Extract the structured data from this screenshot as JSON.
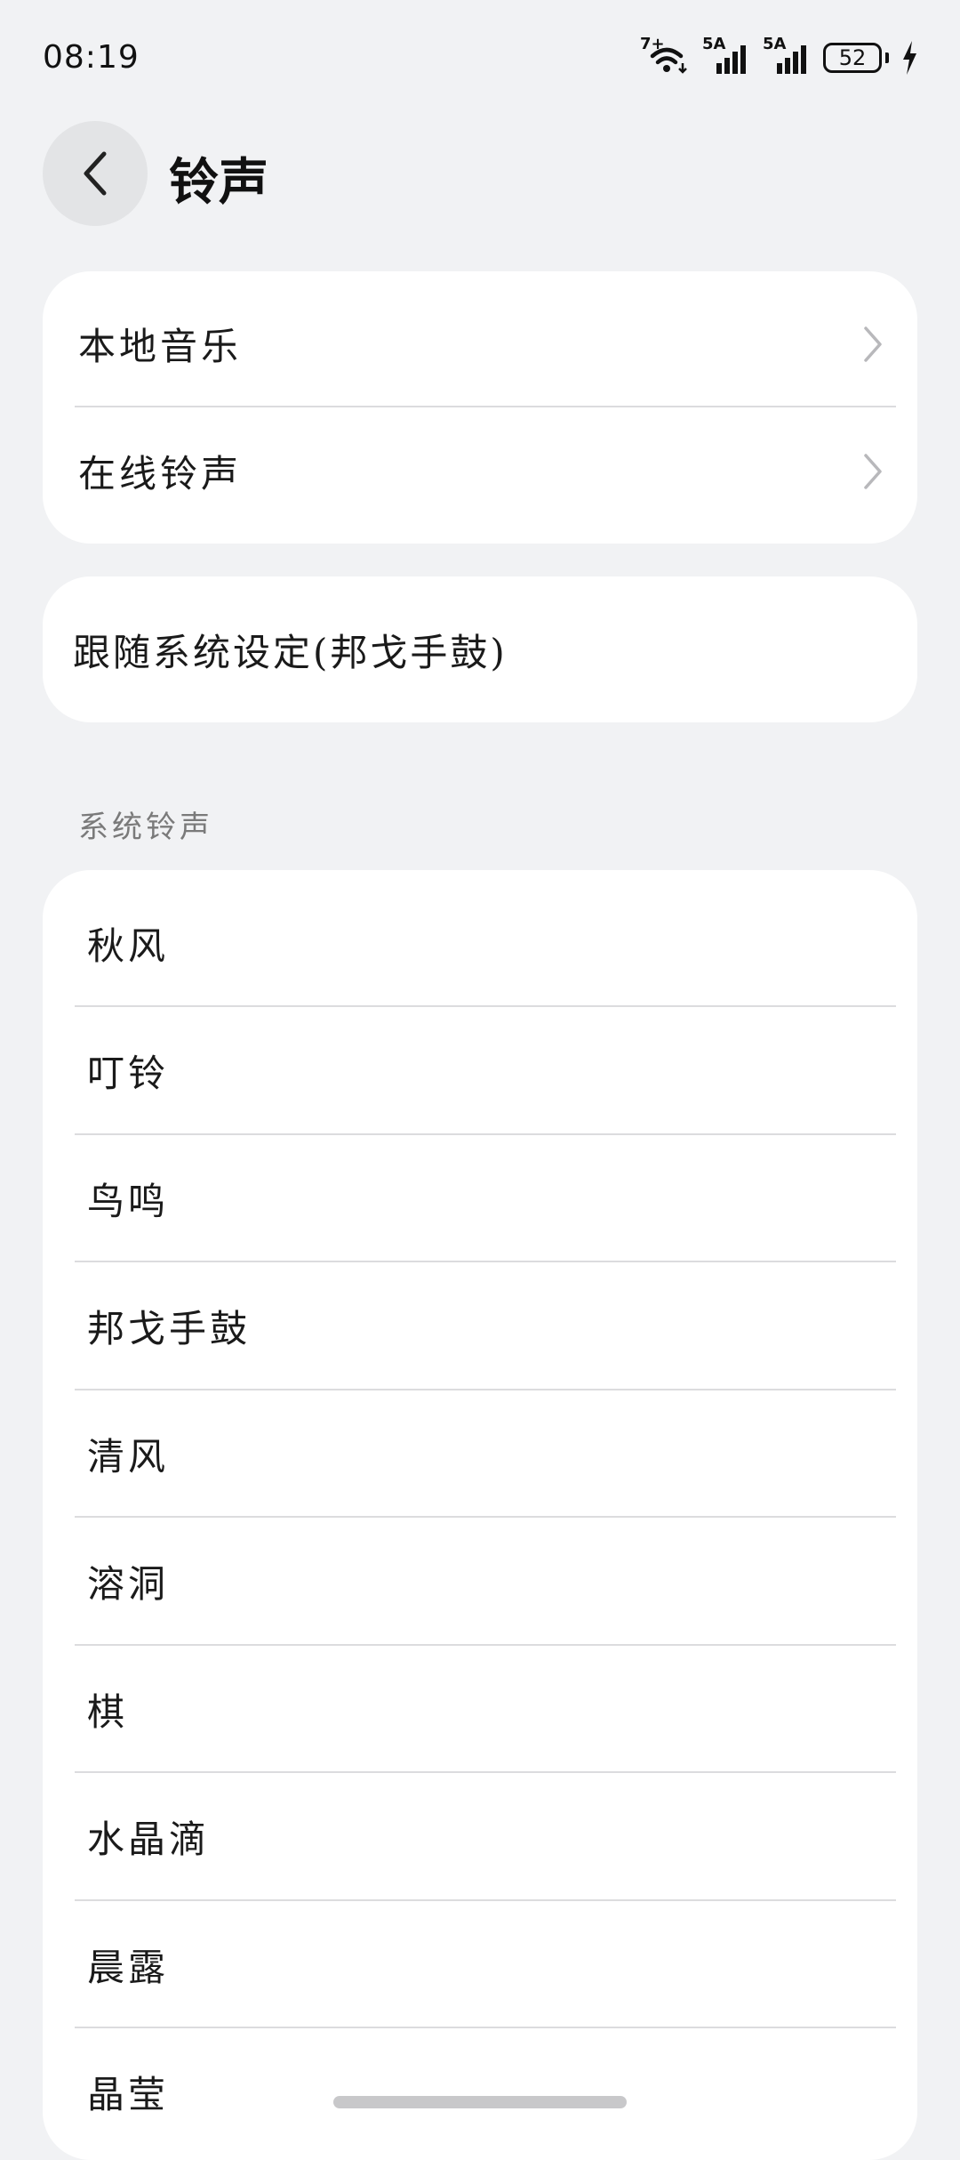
{
  "status_bar": {
    "time": "08:19",
    "wifi_label": "7+",
    "signal1_label": "5A",
    "signal2_label": "5A",
    "battery": "52"
  },
  "header": {
    "title": "铃声"
  },
  "sources": {
    "items": [
      {
        "label": "本地音乐"
      },
      {
        "label": "在线铃声"
      }
    ]
  },
  "follow_system": {
    "label": "跟随系统设定(邦戈手鼓)"
  },
  "system_ringtones": {
    "section_title": "系统铃声",
    "items": [
      {
        "label": "秋风"
      },
      {
        "label": "叮铃"
      },
      {
        "label": "鸟鸣"
      },
      {
        "label": "邦戈手鼓"
      },
      {
        "label": "清风"
      },
      {
        "label": "溶洞"
      },
      {
        "label": "棋"
      },
      {
        "label": "水晶滴"
      },
      {
        "label": "晨露"
      },
      {
        "label": "晶莹"
      }
    ]
  },
  "icons": {
    "back": "chevron-left-icon",
    "row_arrow": "chevron-right-icon",
    "wifi": "wifi-icon",
    "signal": "cell-signal-icon",
    "battery": "battery-icon",
    "charging": "charging-bolt-icon"
  },
  "colors": {
    "background": "#f1f2f4",
    "card": "#ffffff",
    "section_title": "#7a7a7a"
  }
}
